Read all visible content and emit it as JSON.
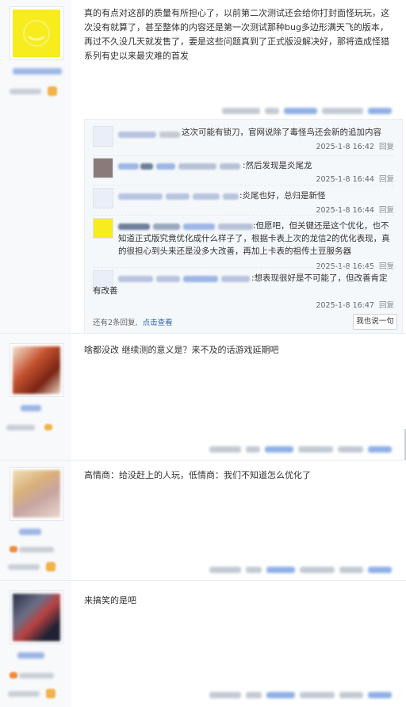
{
  "posts": [
    {
      "avatar": "yellow-face-avatar",
      "content": "真的有点对这部的质量有所担心了，以前第二次测试还会给你打封面怪玩玩，这次没有就算了，甚至整体的内容还是第一次测试那种bug多边形满天飞的版本，再过不久没几天就发售了，要是这些问题真到了正式版没解决好，那将造成怪猎系列有史以来最灾难的首发",
      "replies": [
        {
          "text": "这次可能有锁刀，官网说除了毒怪鸟还会新的追加内容",
          "time": "2025-1-8 16:42",
          "reply_label": "回复"
        },
        {
          "text": ":然后发现是炎尾龙",
          "time": "2025-1-8 16:44",
          "reply_label": "回复"
        },
        {
          "text": ":炎尾也好，总归是新怪",
          "time": "2025-1-8 16:44",
          "reply_label": "回复"
        },
        {
          "text": ":但愿吧，但关键还是这个优化，也不知道正式版究竟优化成什么样子了，根据卡表上次的龙信2的优化表现，真的很担心到头来还是没多大改善，再加上卡表的祖传土豆服务器",
          "time": "2025-1-8 16:45",
          "reply_label": "回复"
        },
        {
          "text": ":想表现很好是不可能了，但改善肯定有改善",
          "time": "2025-1-8 16:47",
          "reply_label": "回复"
        }
      ],
      "more_replies": "还有2条回复,",
      "view_link": "点击查看",
      "say_button": "我也说一句"
    },
    {
      "avatar": "red-character-avatar",
      "content": "啥都没改 继续测的意义是？来不及的话游戏延期吧"
    },
    {
      "avatar": "blonde-character-avatar",
      "content": "高情商：给没赶上的人玩，低情商：我们不知道怎么优化了"
    },
    {
      "avatar": "dark-character-avatar",
      "content": "来搞笑的是吧"
    }
  ],
  "colors": {
    "link": "#2d64b3",
    "badge": "#f2b24a",
    "left_bg": "#f7f9fb",
    "reply_bg": "#f5f8fb"
  }
}
